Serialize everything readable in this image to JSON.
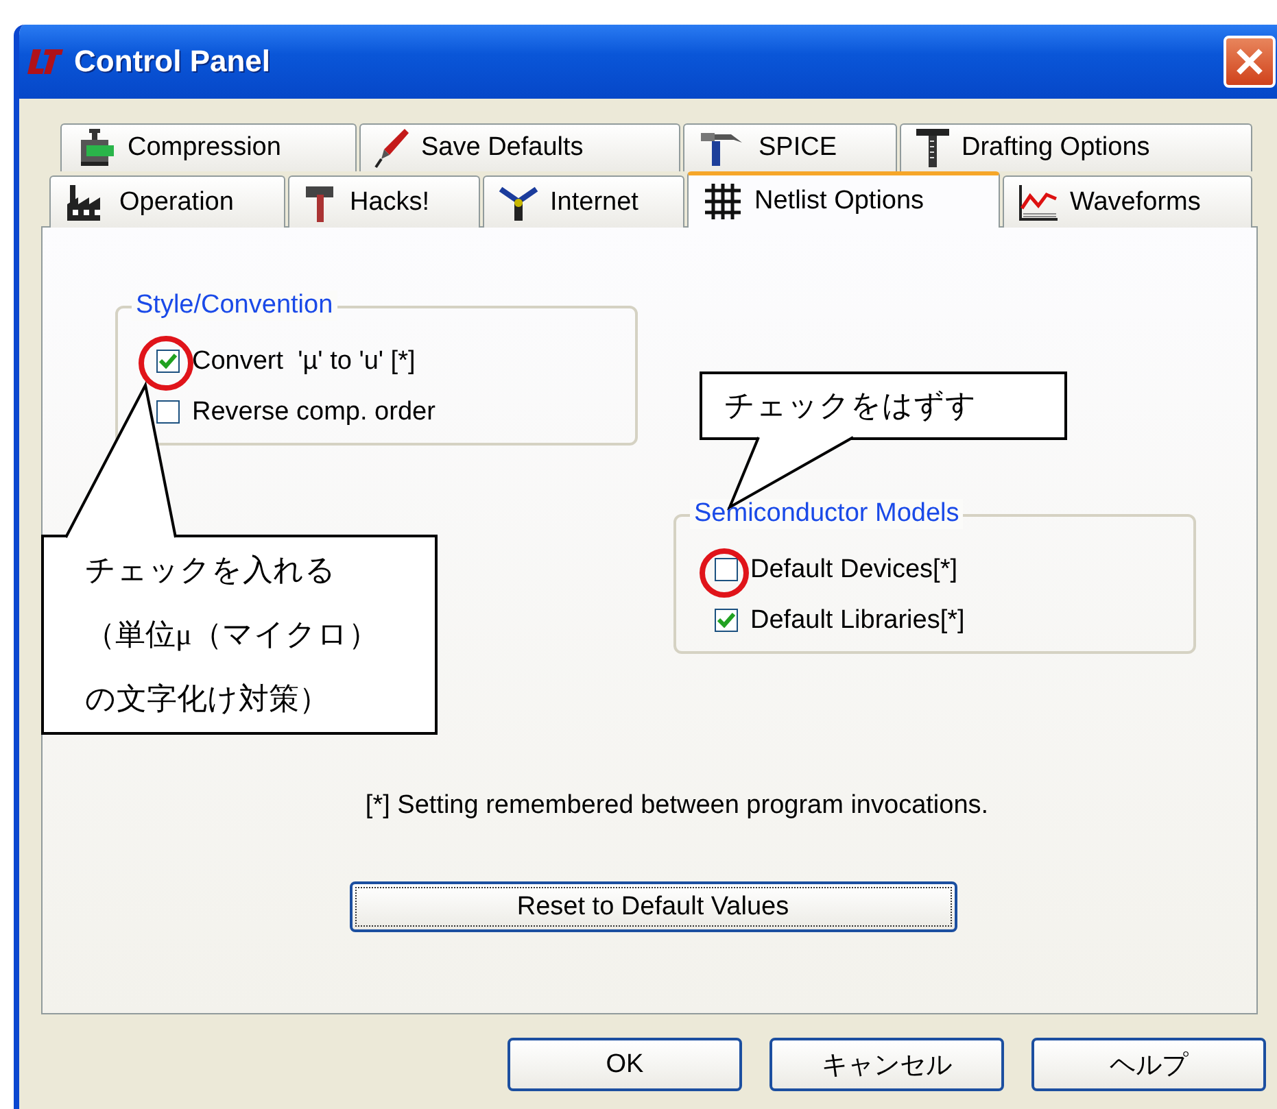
{
  "window": {
    "title": "Control Panel"
  },
  "tab_rows": [
    [
      {
        "label": "Compression",
        "selected": false
      },
      {
        "label": "Save Defaults",
        "selected": false
      },
      {
        "label": "SPICE",
        "selected": false
      },
      {
        "label": "Drafting Options",
        "selected": false
      }
    ],
    [
      {
        "label": "Operation",
        "selected": false
      },
      {
        "label": "Hacks!",
        "selected": false
      },
      {
        "label": "Internet",
        "selected": false
      },
      {
        "label": "Netlist Options",
        "selected": true
      },
      {
        "label": "Waveforms",
        "selected": false
      }
    ]
  ],
  "groups": [
    {
      "title": "Style/Convention",
      "options": [
        {
          "label": "Convert  'µ' to 'u' [*]",
          "checked": true
        },
        {
          "label": "Reverse comp. order",
          "checked": false
        }
      ]
    },
    {
      "title": "Semiconductor Models",
      "options": [
        {
          "label": "Default Devices[*]",
          "checked": false
        },
        {
          "label": "Default Libraries[*]",
          "checked": true
        }
      ]
    }
  ],
  "footnote": "[*] Setting remembered between program invocations.",
  "reset_button": "Reset to Default Values",
  "buttons": [
    "OK",
    "キャンセル",
    "ヘルプ"
  ],
  "annotations": [
    {
      "lines": [
        "チェックを入れる",
        "（単位μ（マイクロ）",
        "の文字化け対策）"
      ]
    },
    {
      "lines": [
        "チェックをはずす"
      ]
    }
  ]
}
